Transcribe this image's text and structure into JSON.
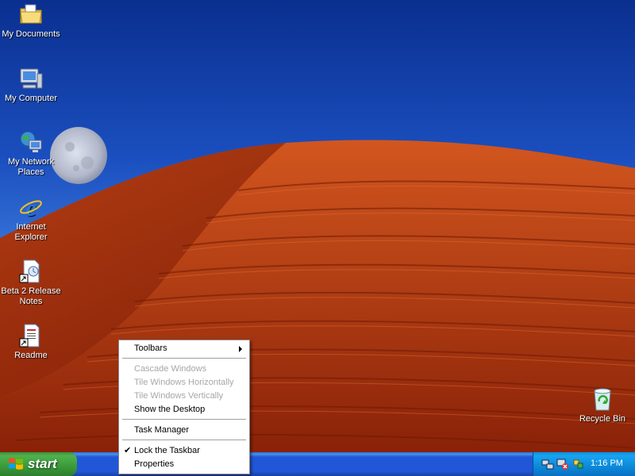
{
  "desktop_icons": [
    {
      "name": "my-documents",
      "label": "My Documents",
      "icon": "folder-documents-icon"
    },
    {
      "name": "my-computer",
      "label": "My Computer",
      "icon": "computer-icon"
    },
    {
      "name": "my-network-places",
      "label": "My Network Places",
      "icon": "network-icon"
    },
    {
      "name": "internet-explorer",
      "label": "Internet Explorer",
      "icon": "internet-explorer-icon"
    },
    {
      "name": "beta2-release-notes",
      "label": "Beta 2 Release Notes",
      "icon": "release-notes-shortcut-icon"
    },
    {
      "name": "readme",
      "label": "Readme",
      "icon": "readme-shortcut-icon"
    },
    {
      "name": "recycle-bin",
      "label": "Recycle Bin",
      "icon": "recycle-bin-icon"
    }
  ],
  "taskbar": {
    "start_label": "start",
    "clock": "1:16 PM",
    "tray_icons": [
      "network-tray-icon",
      "network-error-tray-icon",
      "update-tray-icon"
    ]
  },
  "context_menu": {
    "items": [
      {
        "label": "Toolbars",
        "enabled": true,
        "submenu": true
      },
      {
        "label": "Cascade Windows",
        "enabled": false
      },
      {
        "label": "Tile Windows Horizontally",
        "enabled": false
      },
      {
        "label": "Tile Windows Vertically",
        "enabled": false
      },
      {
        "label": "Show the Desktop",
        "enabled": true
      },
      {
        "label": "Task Manager",
        "enabled": true
      },
      {
        "label": "Lock the Taskbar",
        "enabled": true,
        "checked": true
      },
      {
        "label": "Properties",
        "enabled": true
      }
    ]
  },
  "colors": {
    "taskbar_blue": "#2157d7",
    "start_green": "#3a9a3a",
    "tray_blue": "#0b83d5",
    "dune_red": "#c0421a"
  }
}
